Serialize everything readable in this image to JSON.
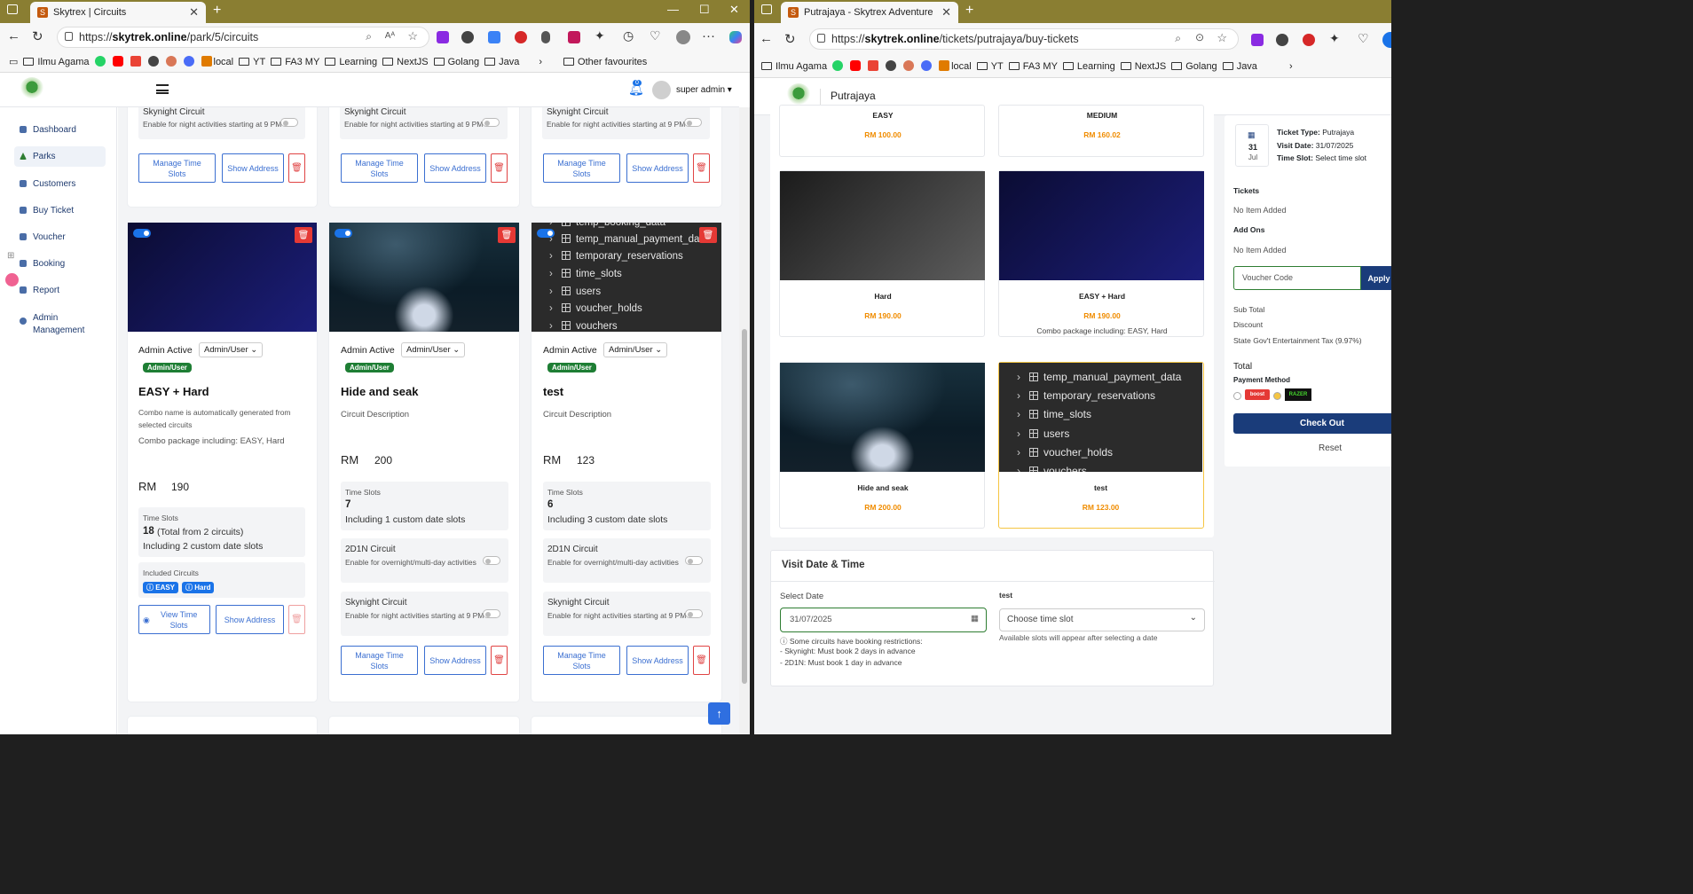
{
  "left_browser": {
    "tab_title": "Skytrex | Circuits",
    "url_prefix": "https://",
    "url_domain": "skytrek.online",
    "url_path": "/park/5/circuits",
    "bookmarks": [
      "Ilmu Agama",
      "local",
      "YT",
      "FA3 MY",
      "Learning",
      "NextJS",
      "Golang",
      "Java",
      "Other favourites"
    ]
  },
  "right_browser": {
    "tab_title": "Putrajaya - Skytrex Adventure",
    "url_prefix": "https://",
    "url_domain": "skytrek.online",
    "url_path": "/tickets/putrajaya/buy-tickets",
    "bookmarks": [
      "Ilmu Agama",
      "local",
      "YT",
      "FA3 MY",
      "Learning",
      "NextJS",
      "Golang",
      "Java"
    ]
  },
  "admin": {
    "notif_count": "0",
    "user_name": "super admin",
    "sidebar": [
      "Dashboard",
      "Parks",
      "Customers",
      "Buy Ticket",
      "Voucher",
      "Booking",
      "Report",
      "Admin Management"
    ],
    "common": {
      "skynight_title": "Skynight Circuit",
      "skynight_desc": "Enable for night activities starting at 9 PM",
      "d2n1_title": "2D1N Circuit",
      "d2n1_desc": "Enable for overnight/multi-day activities",
      "manage": "Manage Time Slots",
      "view": "View Time Slots",
      "show": "Show Address",
      "admin_active": "Admin Active",
      "select": "Admin/User",
      "badge": "Admin/User",
      "time_slots": "Time Slots",
      "rm": "RM",
      "included": "Included Circuits"
    },
    "cards": [
      {
        "title": "EASY + Hard",
        "desc1": "Combo name is automatically generated from selected circuits",
        "desc2": "Combo package including: EASY, Hard",
        "price": "190",
        "slots": "18",
        "slots_note": "(Total from 2 circuits)",
        "custom": "Including 2 custom date slots",
        "chips": [
          "EASY",
          "Hard"
        ]
      },
      {
        "title": "Hide and seak",
        "desc": "Circuit Description",
        "price": "200",
        "slots": "7",
        "custom": "Including 1 custom date slots"
      },
      {
        "title": "test",
        "desc": "Circuit Description",
        "price": "123",
        "slots": "6",
        "custom": "Including 3 custom date slots"
      }
    ],
    "db_rows": [
      "temp_booking_data",
      "temp_manual_payment_dat",
      "temporary_reservations",
      "time_slots",
      "users",
      "voucher_holds",
      "vouchers"
    ]
  },
  "shop": {
    "header": "Putrajaya",
    "items": [
      {
        "name": "EASY",
        "price": "RM 100.00"
      },
      {
        "name": "MEDIUM",
        "price": "RM 160.02"
      },
      {
        "name": "Hard",
        "price": "RM 190.00"
      },
      {
        "name": "EASY + Hard",
        "price": "RM 190.00",
        "desc": "Combo package including: EASY, Hard"
      },
      {
        "name": "Hide and seak",
        "price": "RM 200.00"
      },
      {
        "name": "test",
        "price": "RM 123.00"
      }
    ],
    "db_rows": [
      "temp_manual_payment_data",
      "temporary_reservations",
      "time_slots",
      "users",
      "voucher_holds",
      "vouchers"
    ],
    "visit_title": "Visit Date & Time",
    "select_date": "Select Date",
    "date_value": "31/07/2025",
    "slot_label": "test",
    "slot_placeholder": "Choose time slot",
    "slot_hint": "Available slots will appear after selecting a date",
    "restrict_note": "Some circuits have booking restrictions:",
    "restrict_1": "- Skynight: Must book 2 days in advance",
    "restrict_2": "- 2D1N: Must book 1 day in advance",
    "summary": {
      "cal_day": "31",
      "cal_month": "Jul",
      "ticket_type_label": "Ticket Type:",
      "ticket_type": "Putrajaya",
      "visit_date_label": "Visit Date:",
      "visit_date": "31/07/2025",
      "time_slot_label": "Time Slot:",
      "time_slot": "Select time slot",
      "tickets": "Tickets",
      "no_item": "No Item Added",
      "addons": "Add Ons",
      "no_item2": "No Item Added",
      "voucher_placeholder": "Voucher Code",
      "apply": "Apply",
      "subtotal": "Sub Total",
      "discount": "Discount",
      "tax": "State Gov't Entertainment Tax (9.97%)",
      "total": "Total",
      "payment": "Payment Method",
      "pm1": "boost",
      "pm2": "RAZER",
      "checkout": "Check Out",
      "reset": "Reset"
    }
  }
}
